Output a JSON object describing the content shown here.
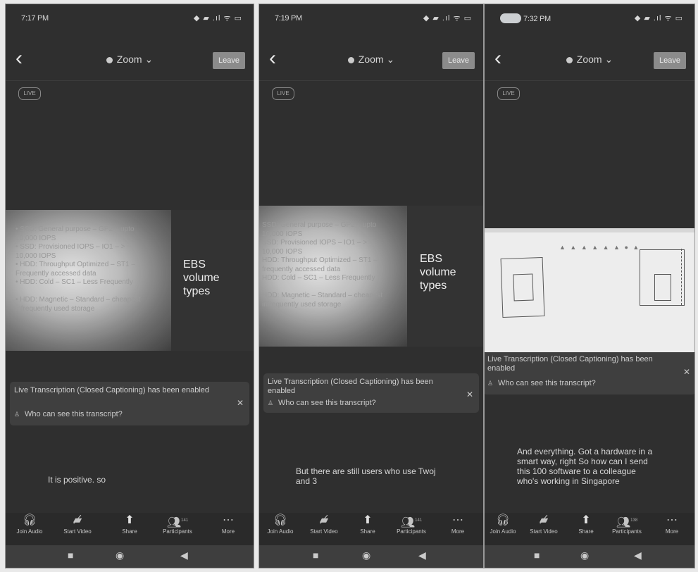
{
  "phones": [
    {
      "status": {
        "time": "7:17 PM",
        "icons": "◆ ▰  .ıl ᯤ ▭"
      },
      "topbar": {
        "title": "Zoom",
        "leave": "Leave"
      },
      "live_badge": "LIVE",
      "slide": {
        "lines": [
          "• SSD: General purpose – GP2 – upto",
          "  10,000 IOPS",
          "• SSD: Provisioned IOPS – IO1 – >",
          "  10,000 IOPS",
          "• HDD: Throughput Optimized – ST1 –",
          "  Frequently accessed data",
          "• HDD: Cold – SC1 – Less Frequently",
          "",
          "• HDD: Magnetic – Standard – cheapest",
          "  infrequently used storage"
        ],
        "heading": [
          "EBS",
          "volume",
          "types"
        ]
      },
      "notice": {
        "message": "Live Transcription (Closed Captioning) has been enabled",
        "who": "Who can see this transcript?"
      },
      "caption": "It is positive. so",
      "toolbar": {
        "join_audio": "Join Audio",
        "start_video": "Start Video",
        "share": "Share",
        "participants": "Participants",
        "participants_count": "141",
        "more": "More"
      }
    },
    {
      "status": {
        "time": "7:19 PM",
        "icons": "◆ ▰  .ıl ᯤ ▭"
      },
      "topbar": {
        "title": "Zoom",
        "leave": "Leave"
      },
      "live_badge": "LIVE",
      "slide": {
        "lines": [
          "SSD: General purpose – GP2 – upto",
          "10,000 IOPS",
          "SSD: Provisioned IOPS – IO1 – >",
          "10,000 IOPS",
          "HDD: Throughput Optimized – ST1 –",
          "frequently accessed data",
          "HDD: Cold – SC1 – Less Frequently",
          "",
          "HDD: Magnetic – Standard – cheapest",
          "infrequently used storage"
        ],
        "heading": [
          "EBS",
          "volume",
          "types"
        ]
      },
      "notice": {
        "message": "Live Transcription (Closed Captioning) has been enabled",
        "who": "Who can see this transcript?"
      },
      "caption": "But there are still users who use Twoj and 3",
      "toolbar": {
        "join_audio": "Join Audio",
        "start_video": "Start Video",
        "share": "Share",
        "participants": "Participants",
        "participants_count": "141",
        "more": "More"
      }
    },
    {
      "status": {
        "time": "7:32 PM",
        "icons": "◆ ▰  .ıl ᯤ ▭"
      },
      "topbar": {
        "title": "Zoom",
        "leave": "Leave"
      },
      "live_badge": "LIVE",
      "whiteboard": {
        "tools": "▲ ▲ ▲ ▲ ▲ ▲ ● ▲"
      },
      "notice": {
        "message": "Live Transcription (Closed Captioning) has been enabled",
        "who": "Who can see this transcript?"
      },
      "caption": "And everything. Got a hardware in a smart way, right So how can I send this 100 software to a colleague who's working in Singapore",
      "toolbar": {
        "join_audio": "Join Audio",
        "start_video": "Start Video",
        "share": "Share",
        "participants": "Participants",
        "participants_count": "138",
        "more": "More"
      }
    }
  ],
  "icons": {
    "back": "chevron-left-icon",
    "dot": "zoom-status-dot",
    "join_audio": "headphones-icon",
    "start_video": "video-off-icon",
    "share": "share-screen-icon",
    "participants": "participants-icon",
    "more": "more-dots-icon",
    "close": "close-icon"
  }
}
